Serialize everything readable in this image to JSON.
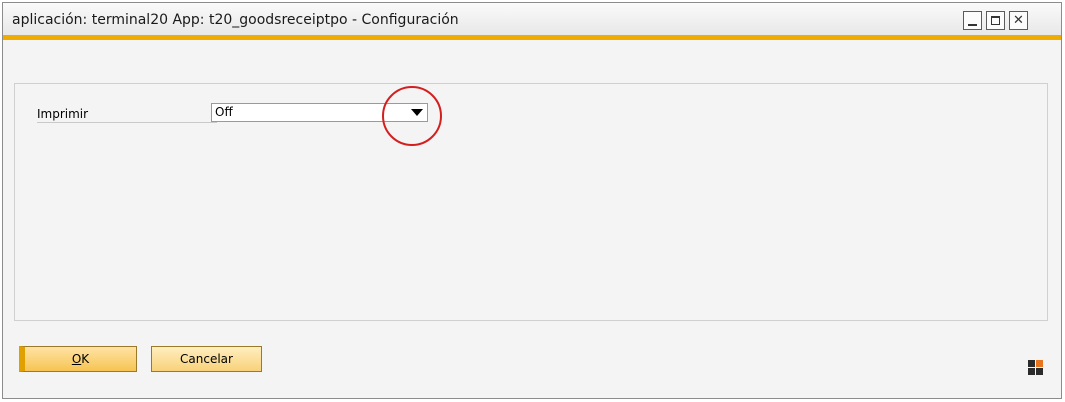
{
  "window": {
    "title": "aplicación: terminal20 App: t20_goodsreceiptpo - Configuración",
    "controls": {
      "minimize_icon": "minimize-icon",
      "maximize_icon": "maximize-icon",
      "close_icon": "close-icon",
      "close_glyph": "✕"
    },
    "accent_color": "#f0ab00"
  },
  "form": {
    "print_label": "Imprimir",
    "print_value": "Off"
  },
  "annotation": {
    "circle_color": "#d41f1f"
  },
  "buttons": {
    "ok_label_underlined": "O",
    "ok_label_rest": "K",
    "cancel_label": "Cancelar"
  },
  "logo": {
    "icon": "sap-logo-icon"
  }
}
